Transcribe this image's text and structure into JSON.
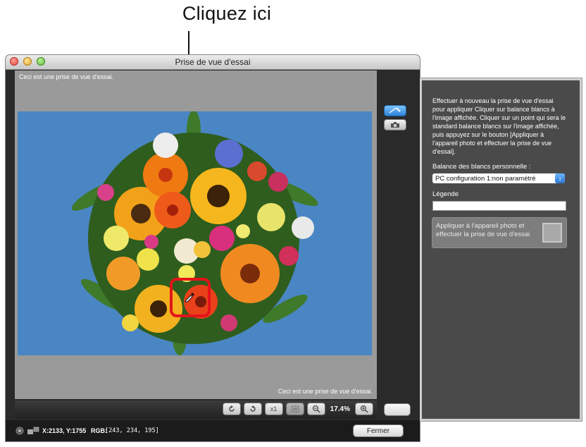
{
  "annotation": {
    "callout": "Cliquez ici"
  },
  "window": {
    "title": "Prise de vue d'essai",
    "caption_top": "Ceci est une prise de vue d'essai.",
    "caption_bottom": "Ceci est une prise de vue d'essai."
  },
  "toolbar": {
    "rotate_left_icon": "rotate-left-icon",
    "rotate_right_icon": "rotate-right-icon",
    "actual_size_label": "x1",
    "fit_icon": "fit-icon",
    "zoom_out_icon": "zoom-out-icon",
    "zoom_level": "17.4%",
    "zoom_in_icon": "zoom-in-icon"
  },
  "statusbar": {
    "coords": "X:2133, Y:1755",
    "rgb_label": "RGB:",
    "rgb_value": "[243, 234, 195]",
    "close_label": "Fermer"
  },
  "panel": {
    "help_text": "Effectuer à nouveau la prise de vue d'essai pour appliquer Cliquer sur balance blancs à l'image affichée. Cliquer sur un point qui sera le standard balance blancs sur l'image affichée, puis appuyez sur le bouton [Appliquer à l'appareil photo et effectuer la prise de vue d'essai].",
    "wb_label": "Balance des blancs personnelle :",
    "wb_selected": "PC configuration 1:non paramétré",
    "legend_label": "Légende",
    "legend_value": "",
    "apply_label": "Appliquer à l'appareil photo et effectuer la prise de vue d'essai"
  },
  "colors": {
    "selection": "#e3141a",
    "background_blue": "#4a86c4",
    "panel_bg": "#4a4a4a"
  }
}
